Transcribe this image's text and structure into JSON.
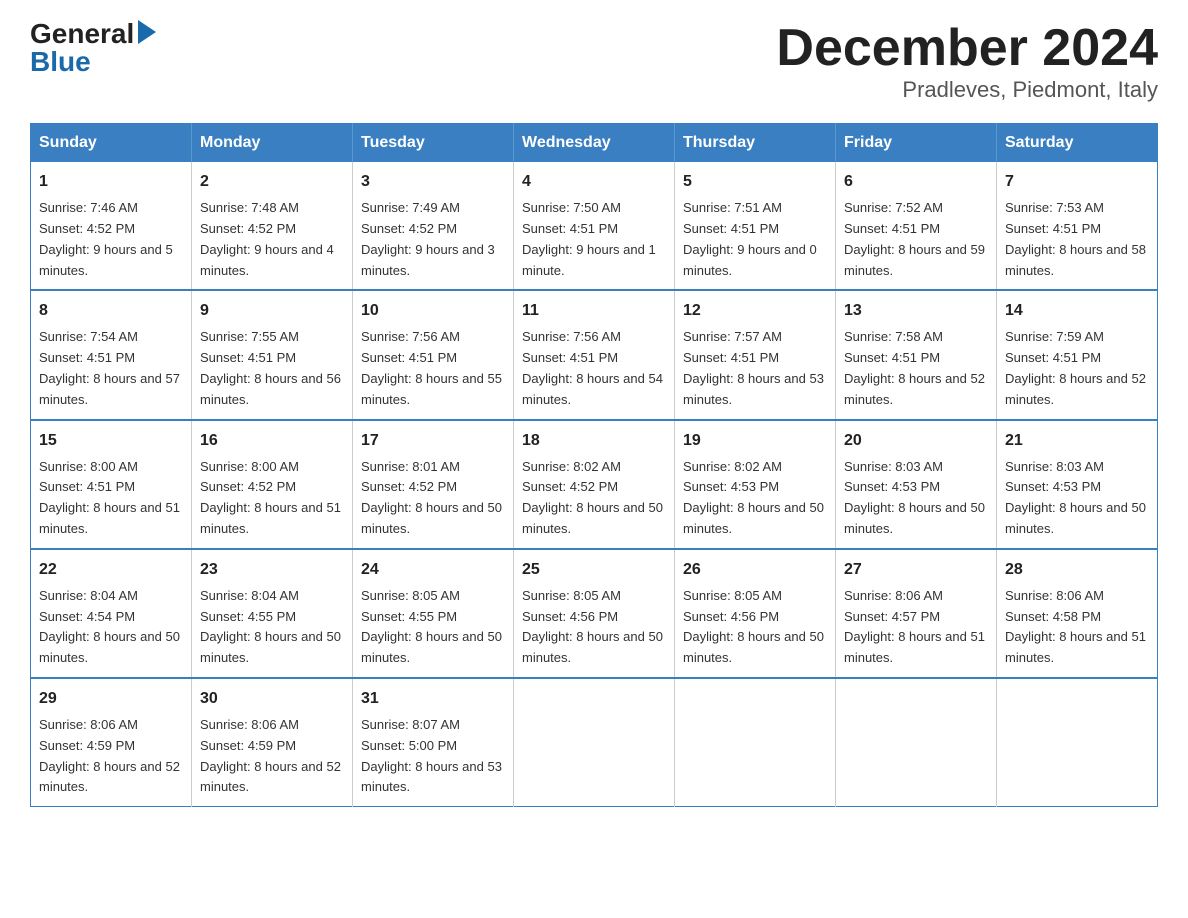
{
  "header": {
    "logo_general": "General",
    "logo_blue": "Blue",
    "title": "December 2024",
    "subtitle": "Pradleves, Piedmont, Italy"
  },
  "calendar": {
    "days_of_week": [
      "Sunday",
      "Monday",
      "Tuesday",
      "Wednesday",
      "Thursday",
      "Friday",
      "Saturday"
    ],
    "weeks": [
      [
        {
          "day": "1",
          "sunrise": "7:46 AM",
          "sunset": "4:52 PM",
          "daylight": "9 hours and 5 minutes."
        },
        {
          "day": "2",
          "sunrise": "7:48 AM",
          "sunset": "4:52 PM",
          "daylight": "9 hours and 4 minutes."
        },
        {
          "day": "3",
          "sunrise": "7:49 AM",
          "sunset": "4:52 PM",
          "daylight": "9 hours and 3 minutes."
        },
        {
          "day": "4",
          "sunrise": "7:50 AM",
          "sunset": "4:51 PM",
          "daylight": "9 hours and 1 minute."
        },
        {
          "day": "5",
          "sunrise": "7:51 AM",
          "sunset": "4:51 PM",
          "daylight": "9 hours and 0 minutes."
        },
        {
          "day": "6",
          "sunrise": "7:52 AM",
          "sunset": "4:51 PM",
          "daylight": "8 hours and 59 minutes."
        },
        {
          "day": "7",
          "sunrise": "7:53 AM",
          "sunset": "4:51 PM",
          "daylight": "8 hours and 58 minutes."
        }
      ],
      [
        {
          "day": "8",
          "sunrise": "7:54 AM",
          "sunset": "4:51 PM",
          "daylight": "8 hours and 57 minutes."
        },
        {
          "day": "9",
          "sunrise": "7:55 AM",
          "sunset": "4:51 PM",
          "daylight": "8 hours and 56 minutes."
        },
        {
          "day": "10",
          "sunrise": "7:56 AM",
          "sunset": "4:51 PM",
          "daylight": "8 hours and 55 minutes."
        },
        {
          "day": "11",
          "sunrise": "7:56 AM",
          "sunset": "4:51 PM",
          "daylight": "8 hours and 54 minutes."
        },
        {
          "day": "12",
          "sunrise": "7:57 AM",
          "sunset": "4:51 PM",
          "daylight": "8 hours and 53 minutes."
        },
        {
          "day": "13",
          "sunrise": "7:58 AM",
          "sunset": "4:51 PM",
          "daylight": "8 hours and 52 minutes."
        },
        {
          "day": "14",
          "sunrise": "7:59 AM",
          "sunset": "4:51 PM",
          "daylight": "8 hours and 52 minutes."
        }
      ],
      [
        {
          "day": "15",
          "sunrise": "8:00 AM",
          "sunset": "4:51 PM",
          "daylight": "8 hours and 51 minutes."
        },
        {
          "day": "16",
          "sunrise": "8:00 AM",
          "sunset": "4:52 PM",
          "daylight": "8 hours and 51 minutes."
        },
        {
          "day": "17",
          "sunrise": "8:01 AM",
          "sunset": "4:52 PM",
          "daylight": "8 hours and 50 minutes."
        },
        {
          "day": "18",
          "sunrise": "8:02 AM",
          "sunset": "4:52 PM",
          "daylight": "8 hours and 50 minutes."
        },
        {
          "day": "19",
          "sunrise": "8:02 AM",
          "sunset": "4:53 PM",
          "daylight": "8 hours and 50 minutes."
        },
        {
          "day": "20",
          "sunrise": "8:03 AM",
          "sunset": "4:53 PM",
          "daylight": "8 hours and 50 minutes."
        },
        {
          "day": "21",
          "sunrise": "8:03 AM",
          "sunset": "4:53 PM",
          "daylight": "8 hours and 50 minutes."
        }
      ],
      [
        {
          "day": "22",
          "sunrise": "8:04 AM",
          "sunset": "4:54 PM",
          "daylight": "8 hours and 50 minutes."
        },
        {
          "day": "23",
          "sunrise": "8:04 AM",
          "sunset": "4:55 PM",
          "daylight": "8 hours and 50 minutes."
        },
        {
          "day": "24",
          "sunrise": "8:05 AM",
          "sunset": "4:55 PM",
          "daylight": "8 hours and 50 minutes."
        },
        {
          "day": "25",
          "sunrise": "8:05 AM",
          "sunset": "4:56 PM",
          "daylight": "8 hours and 50 minutes."
        },
        {
          "day": "26",
          "sunrise": "8:05 AM",
          "sunset": "4:56 PM",
          "daylight": "8 hours and 50 minutes."
        },
        {
          "day": "27",
          "sunrise": "8:06 AM",
          "sunset": "4:57 PM",
          "daylight": "8 hours and 51 minutes."
        },
        {
          "day": "28",
          "sunrise": "8:06 AM",
          "sunset": "4:58 PM",
          "daylight": "8 hours and 51 minutes."
        }
      ],
      [
        {
          "day": "29",
          "sunrise": "8:06 AM",
          "sunset": "4:59 PM",
          "daylight": "8 hours and 52 minutes."
        },
        {
          "day": "30",
          "sunrise": "8:06 AM",
          "sunset": "4:59 PM",
          "daylight": "8 hours and 52 minutes."
        },
        {
          "day": "31",
          "sunrise": "8:07 AM",
          "sunset": "5:00 PM",
          "daylight": "8 hours and 53 minutes."
        },
        null,
        null,
        null,
        null
      ]
    ],
    "labels": {
      "sunrise": "Sunrise:",
      "sunset": "Sunset:",
      "daylight": "Daylight:"
    }
  }
}
